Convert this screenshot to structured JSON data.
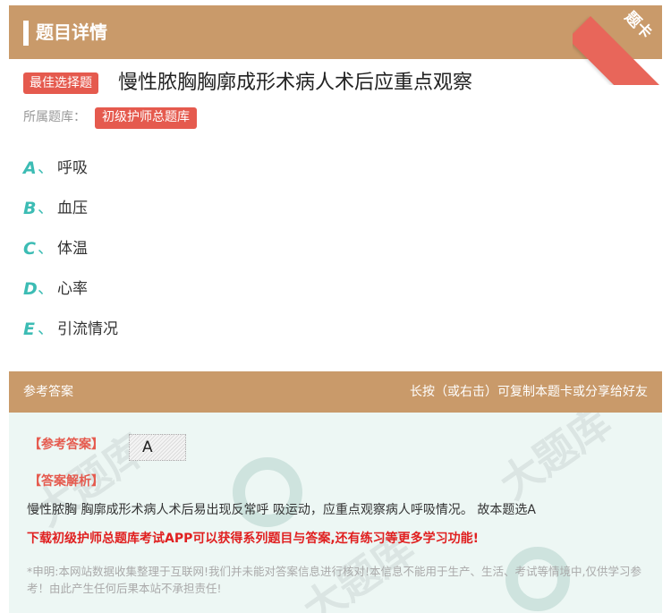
{
  "header": {
    "title": "题目详情",
    "corner_label": "题卡"
  },
  "question": {
    "type_badge": "最佳选择题",
    "text": "慢性脓胸胸廓成形术病人术后应重点观察",
    "bank_label": "所属题库：",
    "bank_name": "初级护师总题库"
  },
  "options": [
    {
      "letter": "A",
      "sep": "、",
      "text": "呼吸"
    },
    {
      "letter": "B",
      "sep": "、",
      "text": "血压"
    },
    {
      "letter": "C",
      "sep": "、",
      "text": "体温"
    },
    {
      "letter": "D",
      "sep": "、",
      "text": "心率"
    },
    {
      "letter": "E",
      "sep": "、",
      "text": "引流情况"
    }
  ],
  "answer_section": {
    "header_left": "参考答案",
    "header_right": "长按（或右击）可复制本题卡或分享给好友",
    "ref_label": "【参考答案】",
    "answer": "A",
    "analysis_label": "【答案解析】",
    "analysis_text": "慢性脓胸 胸廓成形术病人术后易出现反常呼 吸运动，应重点观察病人呼吸情况。 故本题选A",
    "promo": "下载初级护师总题库考试APP可以获得系列题目与答案,还有练习等更多学习功能!",
    "disclaimer": "*申明:本网站数据收集整理于互联网!我们并未能对答案信息进行核对!本信息不能用于生产、生活、考试等情境中,仅供学习参考！由此产生任何后果本站不承担责任!"
  },
  "colors": {
    "header_bg": "#c99a6a",
    "badge_red": "#e55a4e",
    "option_teal": "#3cbcb4",
    "answer_bg": "#edf7f4",
    "promo_red": "#e02020"
  }
}
